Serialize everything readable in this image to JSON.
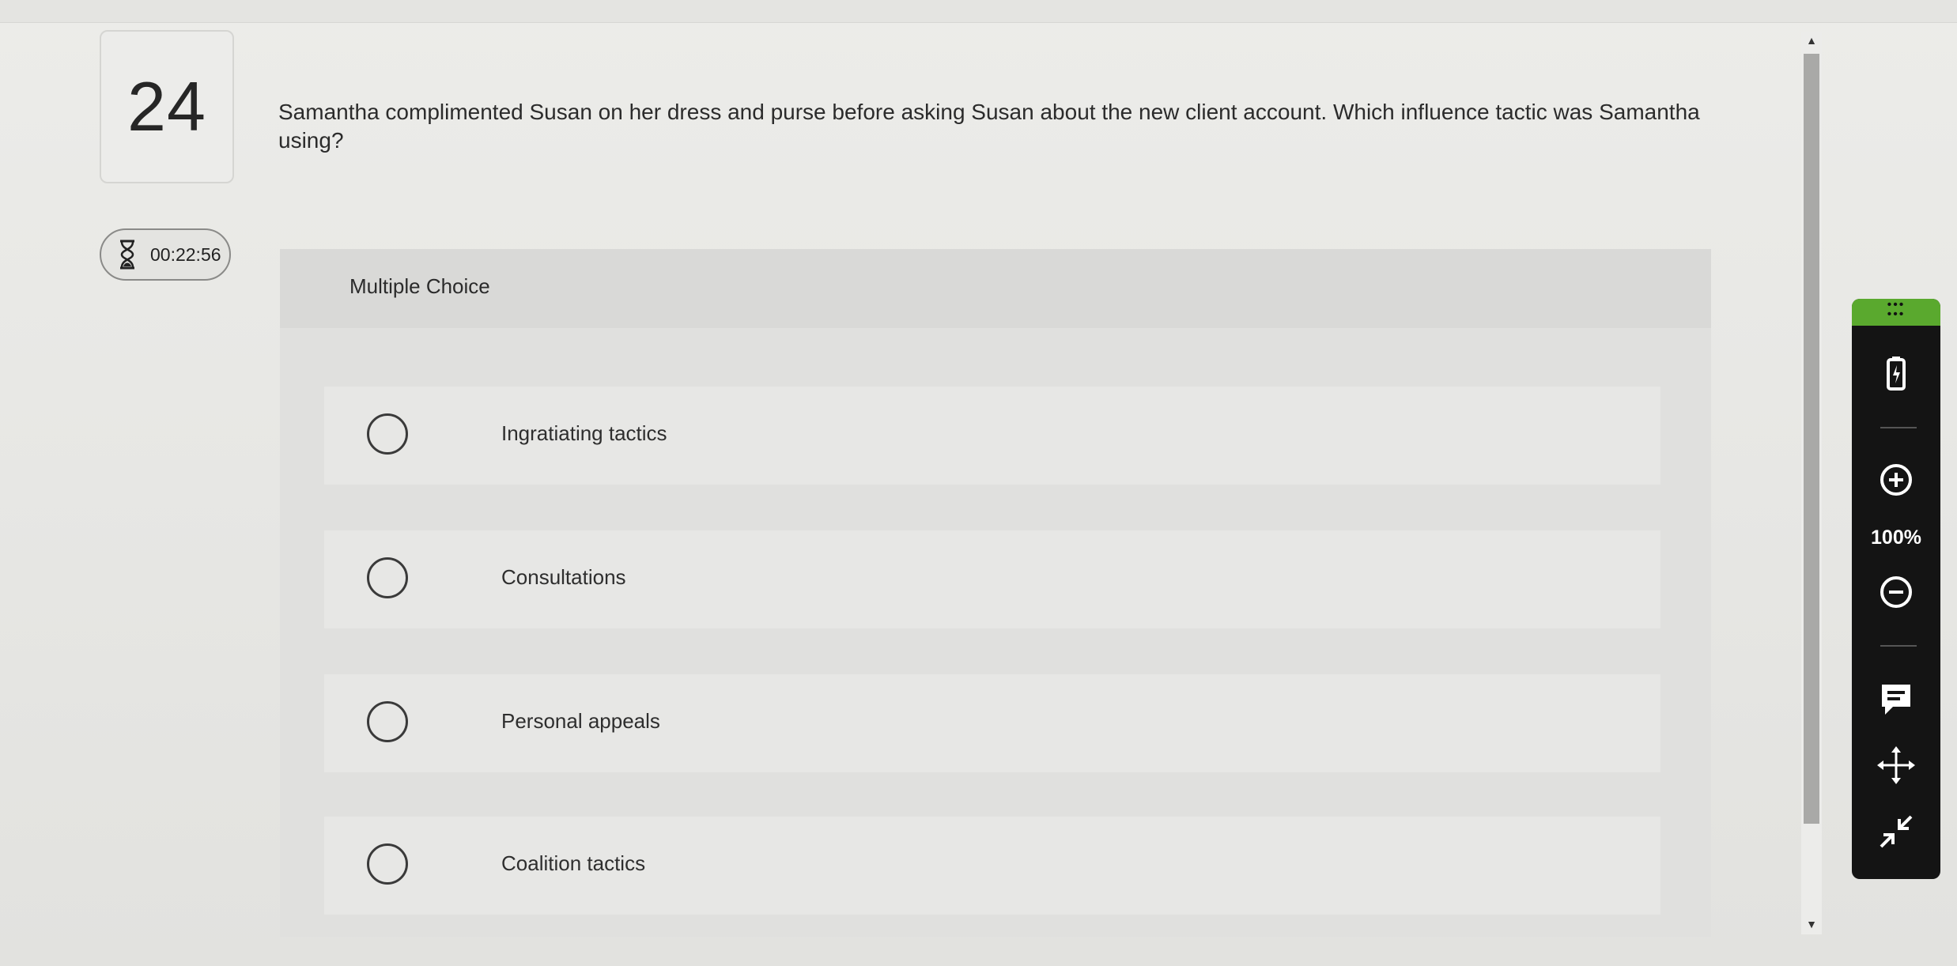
{
  "question": {
    "number": "24",
    "timer": "00:22:56",
    "text": "Samantha complimented Susan on her dress and purse before asking Susan about the new client account. Which influence tactic was Samantha using?"
  },
  "mc": {
    "title": "Multiple Choice",
    "options": [
      {
        "label": "Ingratiating tactics",
        "selected": false
      },
      {
        "label": "Consultations",
        "selected": false
      },
      {
        "label": "Personal appeals",
        "selected": false
      },
      {
        "label": "Coalition tactics",
        "selected": false
      }
    ]
  },
  "toolbar": {
    "zoom": "100%",
    "icons": [
      "grip-icon",
      "battery-icon",
      "zoom-in-icon",
      "zoom-out-icon",
      "comment-icon",
      "move-icon",
      "collapse-icon"
    ],
    "accent": "#5aa92e",
    "background": "#141414"
  }
}
